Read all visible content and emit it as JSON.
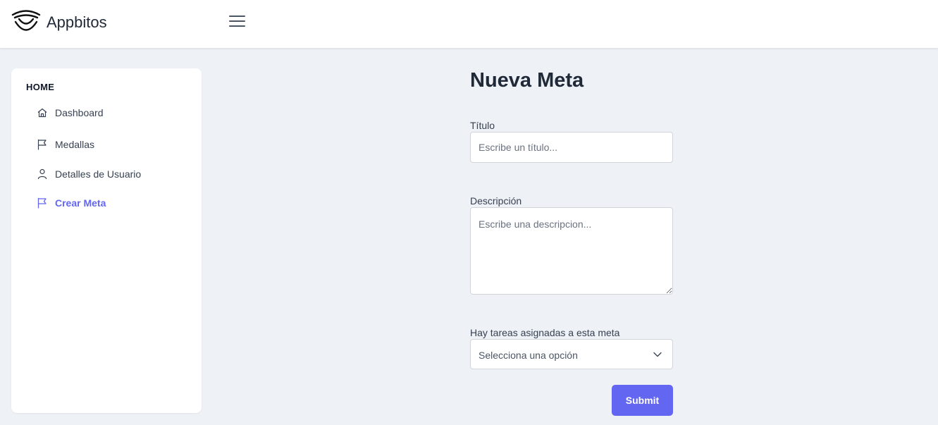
{
  "header": {
    "app_name": "Appbitos",
    "logo_icon": "eye-smile-logo-icon",
    "menu_icon": "hamburger-menu-icon"
  },
  "sidebar": {
    "section_title": "HOME",
    "items": [
      {
        "label": "Dashboard",
        "icon": "home-icon",
        "active": false
      },
      {
        "label": "Medallas",
        "icon": "flag-icon",
        "active": false
      },
      {
        "label": "Detalles de Usuario",
        "icon": "user-icon",
        "active": false
      },
      {
        "label": "Crear Meta",
        "icon": "flag-icon",
        "active": true
      }
    ]
  },
  "form": {
    "title": "Nueva Meta",
    "title_field": {
      "label": "Título",
      "placeholder": "Escribe un título...",
      "value": ""
    },
    "description_field": {
      "label": "Descripción",
      "placeholder": "Escribe una descripcion...",
      "value": ""
    },
    "tasks_field": {
      "label": "Hay tareas asignadas a esta meta",
      "selected": "Selecciona una opción"
    },
    "submit_label": "Submit"
  },
  "colors": {
    "accent": "#6366f1",
    "background": "#eef1f6",
    "surface": "#ffffff",
    "text": "#1f2937"
  }
}
